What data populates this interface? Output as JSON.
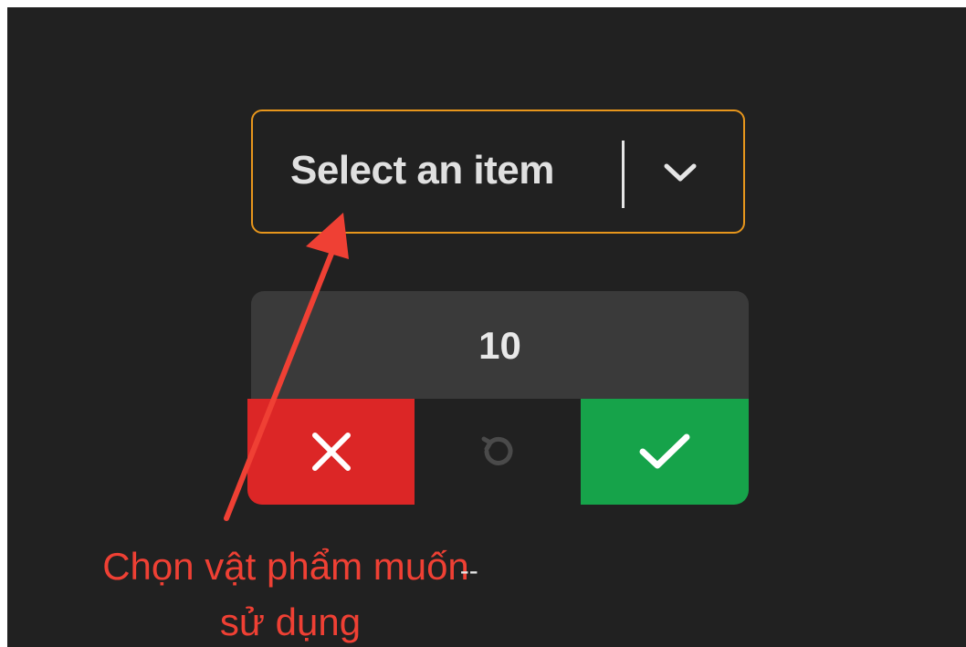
{
  "select": {
    "placeholder": "Select an item",
    "icon": "chevron-down-icon",
    "border_color": "#e7961c"
  },
  "quantity": {
    "value": "10"
  },
  "actions": {
    "cancel_icon": "close-icon",
    "cancel_color": "#dc2626",
    "reset_icon": "undo-icon",
    "confirm_icon": "check-icon",
    "confirm_color": "#16a34a"
  },
  "annotation": {
    "line1": "Chọn vật phẩm muốn",
    "line1_suffix": "--",
    "line2": "sử dụng",
    "color": "#ef4034"
  }
}
